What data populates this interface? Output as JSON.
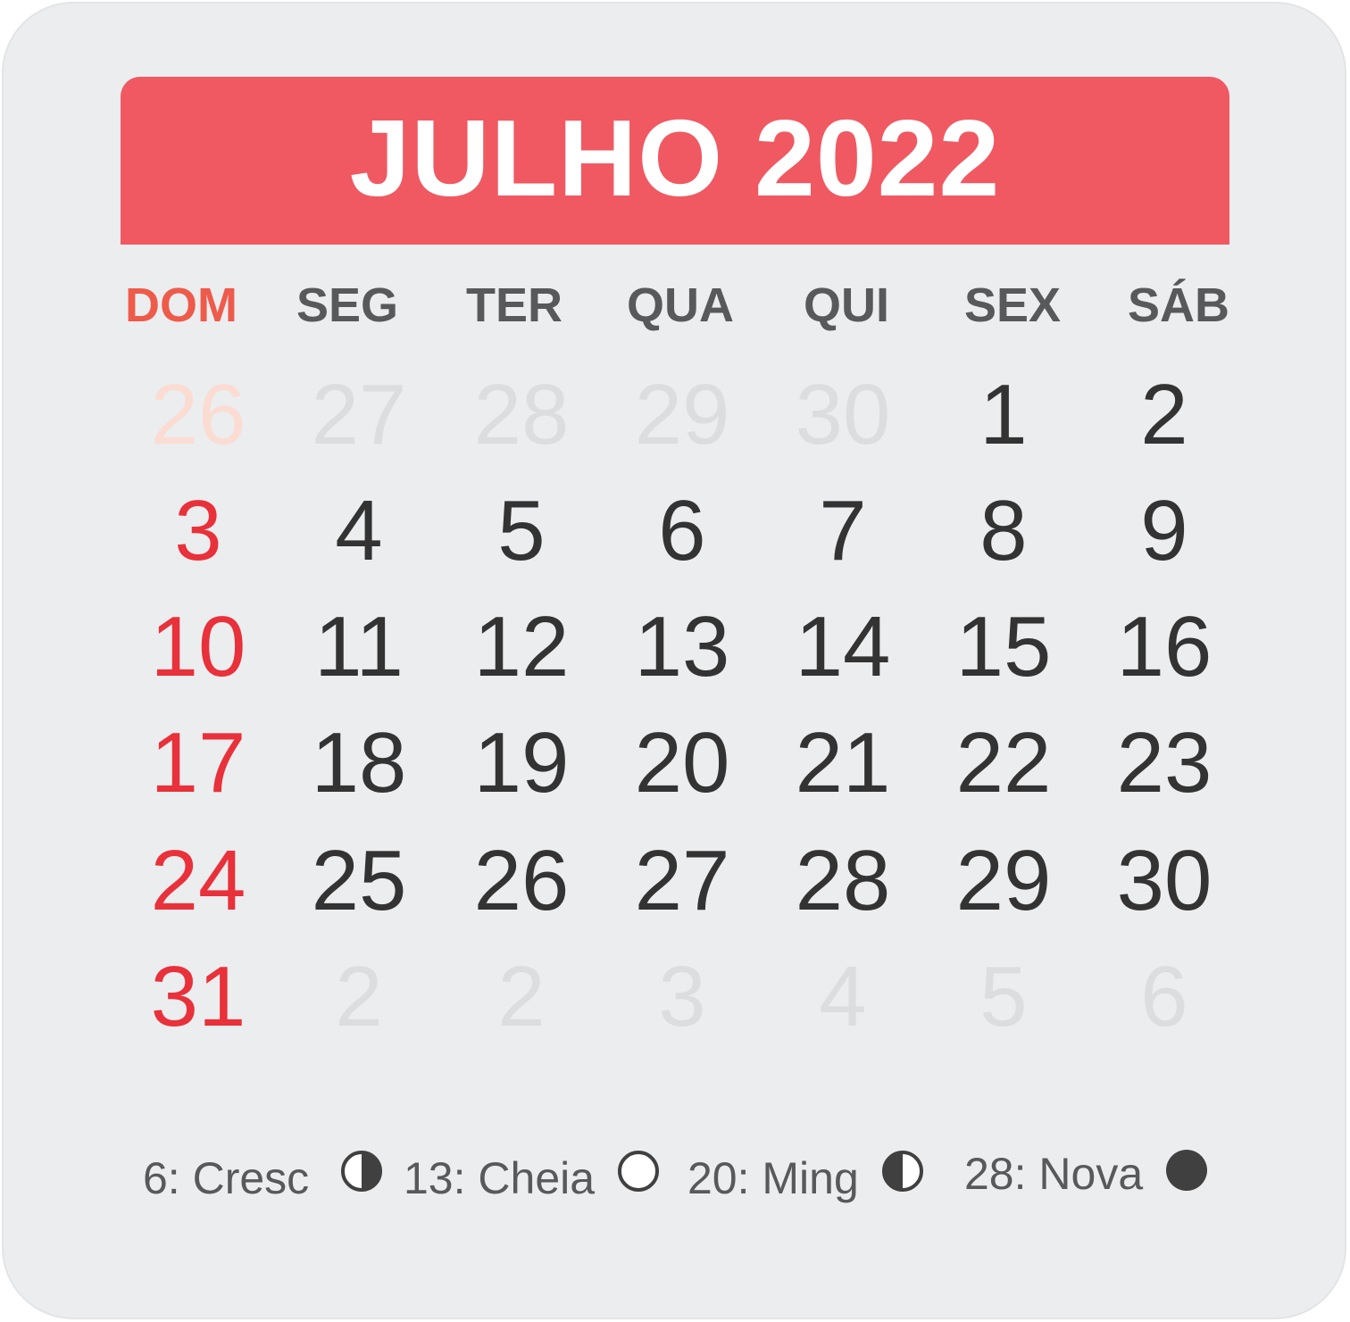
{
  "title": "JULHO 2022",
  "weekdays": [
    "DOM",
    "SEG",
    "TER",
    "QUA",
    "QUI",
    "SEX",
    "SÁB"
  ],
  "weeks": [
    [
      "26",
      "27",
      "28",
      "29",
      "30",
      "1",
      "2"
    ],
    [
      "3",
      "4",
      "5",
      "6",
      "7",
      "8",
      "9"
    ],
    [
      "10",
      "11",
      "12",
      "13",
      "14",
      "15",
      "16"
    ],
    [
      "17",
      "18",
      "19",
      "20",
      "21",
      "22",
      "23"
    ],
    [
      "24",
      "25",
      "26",
      "27",
      "28",
      "29",
      "30"
    ],
    [
      "31",
      "2",
      "2",
      "3",
      "4",
      "5",
      "6"
    ]
  ],
  "outside_month": [
    [
      true,
      true,
      true,
      true,
      true,
      false,
      false
    ],
    [
      false,
      false,
      false,
      false,
      false,
      false,
      false
    ],
    [
      false,
      false,
      false,
      false,
      false,
      false,
      false
    ],
    [
      false,
      false,
      false,
      false,
      false,
      false,
      false
    ],
    [
      false,
      false,
      false,
      false,
      false,
      false,
      false
    ],
    [
      false,
      true,
      true,
      true,
      true,
      true,
      true
    ]
  ],
  "moon_phases": [
    {
      "label": "6: Cresc",
      "icon": "first-quarter-moon-icon"
    },
    {
      "label": "13: Cheia",
      "icon": "full-moon-icon"
    },
    {
      "label": "20: Ming",
      "icon": "last-quarter-moon-icon"
    },
    {
      "label": "28: Nova",
      "icon": "new-moon-icon"
    }
  ],
  "colors": {
    "header": "#f05962",
    "sunday": "#e8313a",
    "weekday_sunday": "#ee5b4b",
    "text": "#333333",
    "muted": "#dcdddf",
    "background": "#ecedef"
  }
}
